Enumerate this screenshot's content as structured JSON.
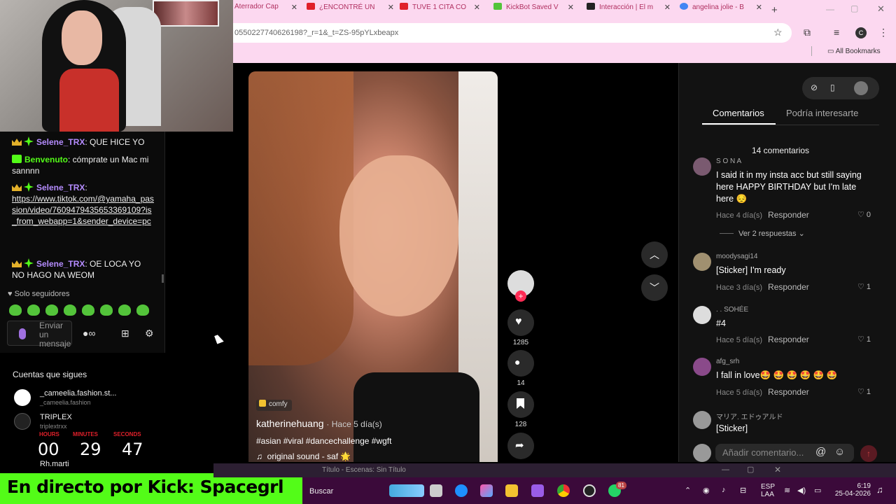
{
  "chat": {
    "messages": [
      {
        "user": "Selene_TRX",
        "text": ": QUE HICE YO"
      },
      {
        "user": "Benvenuto",
        "text": ": cómprate un Mac mi sannnn"
      },
      {
        "user": "Selene_TRX",
        "text": ":",
        "link": "https://www.tiktok.com/@yamaha_passion/video/7609479435653369109?is_from_webapp=1&sender_device=pc"
      },
      {
        "user": "Selene_TRX",
        "text": ": OE LOCA YO NO HAGO NA WEOM"
      }
    ],
    "solo_label": "Solo seguidores",
    "input_placeholder": "Enviar un mensaje",
    "user_colors": {
      "selene": "#b58cff",
      "benvenuto": "#53fc18"
    }
  },
  "follows": {
    "title": "Cuentas que sigues",
    "items": [
      {
        "name": "_cameelia.fashion.st...",
        "sub": "_cameelia.fashion"
      },
      {
        "name": "TRIPLEX",
        "sub": "triplextrxx"
      },
      {
        "name": "Rh.marti",
        "sub": ""
      }
    ]
  },
  "countdown": {
    "labels": [
      "HOURS",
      "MINUTES",
      "SECONDS"
    ],
    "values": [
      "00",
      "29",
      "47"
    ]
  },
  "banner": {
    "text": "En directo por Kick: Spacegrl"
  },
  "browser": {
    "tabs": [
      {
        "label": "Aterrador Cap",
        "color": "#b03060"
      },
      {
        "label": "¿ENCONTRÉ UN",
        "color": "#e0202a"
      },
      {
        "label": "TUVE 1 CITA CO",
        "color": "#e0202a"
      },
      {
        "label": "KickBot Saved V",
        "color": "#53c43a"
      },
      {
        "label": "Interacción | El m",
        "color": "#222222"
      },
      {
        "label": "angelina jolie - B",
        "color": "#4285f4"
      }
    ],
    "url": "0550227740626198?_r=1&_t=ZS-95pYLxbeapx",
    "bookmarks_label": "All Bookmarks",
    "profile_initial": "C"
  },
  "video": {
    "tag": "comfy",
    "author": "katherinehuang",
    "posted": "· Hace 5 día(s)",
    "hashtags": "#asian #viral #dancechallenge #wgft",
    "sound": "original sound - saf 🌟",
    "likes": "1285",
    "comments": "14",
    "saves": "128"
  },
  "comments_panel": {
    "tabs": [
      "Comentarios",
      "Podría interesarte"
    ],
    "count_label": "14 comentarios",
    "reply_label": "Responder",
    "view_replies": "Ver 2 respuestas",
    "add_placeholder": "Añadir comentario...",
    "items": [
      {
        "user": "S O N A",
        "text": "I said it in my insta acc but still saying here HAPPY BIRTHDAY but I'm late here 😔",
        "time": "Hace 4 día(s)",
        "likes": "0"
      },
      {
        "user": "moodysagi14",
        "text": "[Sticker] I'm ready",
        "time": "Hace 3 día(s)",
        "likes": "1"
      },
      {
        "user": ". . SOHÉE",
        "text": "#4",
        "time": "Hace 5 día(s)",
        "likes": "1"
      },
      {
        "user": "afg_srh",
        "text": "I fall in love🤩 🤩 🤩 🤩 🤩 🤩",
        "time": "Hace 5 día(s)",
        "likes": "1"
      },
      {
        "user": "マリア. エドゥアルド",
        "text": "[Sticker]",
        "time": "",
        "likes": ""
      }
    ]
  },
  "obs": {
    "title": "Título - Escenas: Sin Título"
  },
  "taskbar": {
    "search": "Buscar",
    "lang": "ESP",
    "lang2": "LAA",
    "time": "6:19",
    "date": "25-04-2026",
    "badge": "81"
  }
}
